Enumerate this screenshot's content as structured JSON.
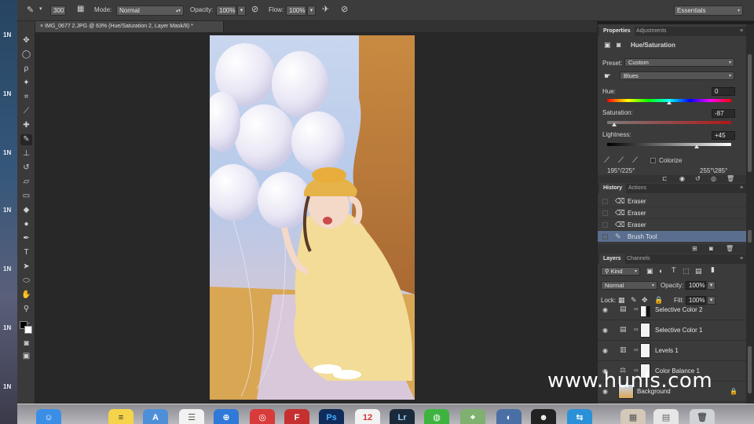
{
  "desktop": {
    "labels": [
      "1N",
      "1N",
      "1N",
      "1N",
      "1N",
      "1N",
      "1N"
    ]
  },
  "options": {
    "brush_size": "300",
    "mode_label": "Mode:",
    "mode_value": "Normal",
    "opacity_label": "Opacity:",
    "opacity_value": "100%",
    "flow_label": "Flow:",
    "flow_value": "100%",
    "workspace": "Essentials"
  },
  "document": {
    "tab_title": "IMG_0677 2.JPG @ 63% (Hue/Saturation 2, Layer Mask/8) *"
  },
  "properties": {
    "tabs": [
      "Properties",
      "Adjustments"
    ],
    "adjustment_title": "Hue/Saturation",
    "preset_label": "Preset:",
    "preset_value": "Custom",
    "channel_value": "Blues",
    "hue_label": "Hue:",
    "hue_value": "0",
    "saturation_label": "Saturation:",
    "saturation_value": "-87",
    "lightness_label": "Lightness:",
    "lightness_value": "+45",
    "colorize_label": "Colorize",
    "range_left": "195°/225°",
    "range_right": "255°\\285°"
  },
  "history": {
    "tabs": [
      "History",
      "Actions"
    ],
    "items": [
      {
        "label": "Eraser"
      },
      {
        "label": "Eraser"
      },
      {
        "label": "Eraser"
      },
      {
        "label": "Brush Tool"
      }
    ]
  },
  "layers": {
    "tabs": [
      "Layers",
      "Channels"
    ],
    "kind_label": "Kind",
    "blend_value": "Normal",
    "opacity_label": "Opacity:",
    "opacity_value": "100%",
    "lock_label": "Lock:",
    "fill_label": "Fill:",
    "fill_value": "100%",
    "items": [
      {
        "name": "Selective Color 2"
      },
      {
        "name": "Selective Color 1"
      },
      {
        "name": "Levels 1"
      },
      {
        "name": "Color Balance 1"
      },
      {
        "name": "Background"
      }
    ]
  },
  "dock": {
    "apps": [
      "Ps",
      "Lr"
    ]
  },
  "watermark": "www.hunls.com",
  "colors": {
    "panel": "#3b3b3b",
    "canvas": "#282828",
    "selected_row": "#5a6f8f"
  }
}
